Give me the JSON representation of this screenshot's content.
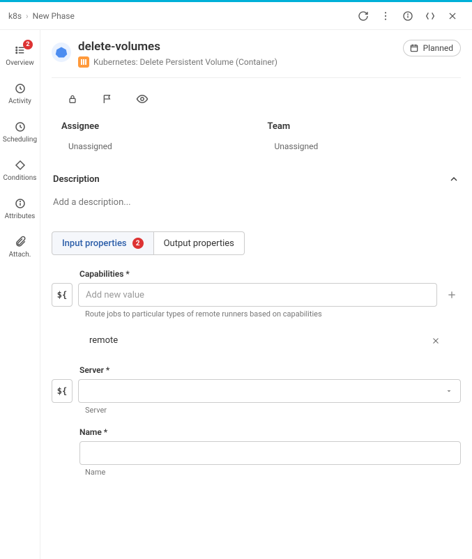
{
  "breadcrumb": {
    "root": "k8s",
    "current": "New Phase"
  },
  "header": {
    "title": "delete-volumes",
    "subtitle": "Kubernetes: Delete Persistent Volume (Container)",
    "status_label": "Planned"
  },
  "sidebar": {
    "items": [
      {
        "label": "Overview",
        "icon": "list-icon",
        "badge": "2"
      },
      {
        "label": "Activity",
        "icon": "clock-icon"
      },
      {
        "label": "Scheduling",
        "icon": "schedule-icon"
      },
      {
        "label": "Conditions",
        "icon": "diamond-icon"
      },
      {
        "label": "Attributes",
        "icon": "info-icon"
      },
      {
        "label": "Attach.",
        "icon": "paperclip-icon"
      }
    ]
  },
  "assignment": {
    "assignee_label": "Assignee",
    "assignee_value": "Unassigned",
    "team_label": "Team",
    "team_value": "Unassigned"
  },
  "description": {
    "section_label": "Description",
    "placeholder": "Add a description..."
  },
  "tabs": {
    "input_label": "Input properties",
    "input_badge": "2",
    "output_label": "Output properties"
  },
  "form": {
    "capabilities": {
      "label": "Capabilities *",
      "placeholder": "Add new value",
      "help": "Route jobs to particular types of remote runners based on capabilities",
      "values": [
        "remote"
      ]
    },
    "server": {
      "label": "Server *",
      "selected": "",
      "help": "Server"
    },
    "name": {
      "label": "Name *",
      "value": "",
      "help": "Name"
    }
  },
  "prefix_symbol": "${"
}
